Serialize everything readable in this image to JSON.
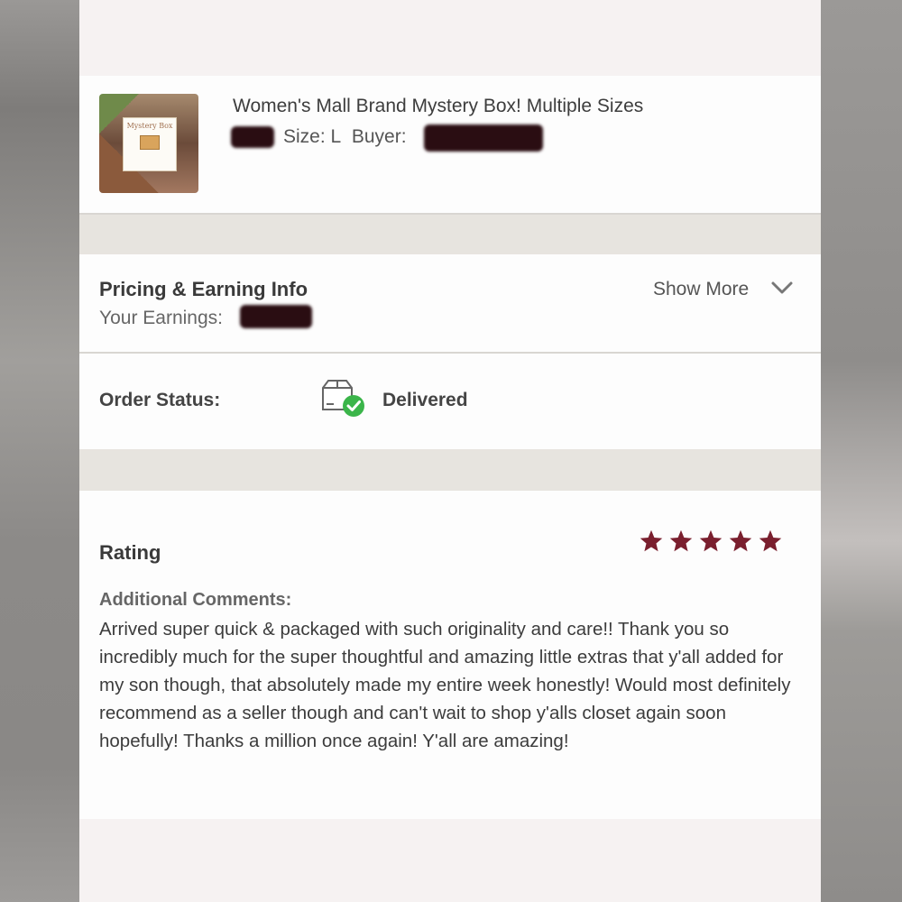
{
  "product": {
    "title": "Women's Mall Brand Mystery Box! Multiple Sizes",
    "size_text": "Size: L",
    "buyer_label": "Buyer:",
    "thumbnail_text": "Mystery Box"
  },
  "pricing": {
    "title": "Pricing & Earning Info",
    "earnings_label": "Your Earnings:",
    "show_more_label": "Show More"
  },
  "order": {
    "status_label": "Order Status:",
    "status_value": "Delivered"
  },
  "rating": {
    "label": "Rating",
    "stars": 5,
    "max_stars": 5,
    "star_color": "#7a1f2e",
    "comments_label": "Additional Comments:",
    "comment": "Arrived super quick & packaged with such originality and care!! Thank you so incredibly much for the super thoughtful and amazing little extras that y'all added for my son though, that absolutely made my entire week honestly! Would most definitely recommend as a seller though and can't wait to shop y'alls closet again soon hopefully! Thanks a million once again! Y'all are amazing!"
  },
  "colors": {
    "status_check": "#3bb54a",
    "redaction": "#2a0d12"
  }
}
